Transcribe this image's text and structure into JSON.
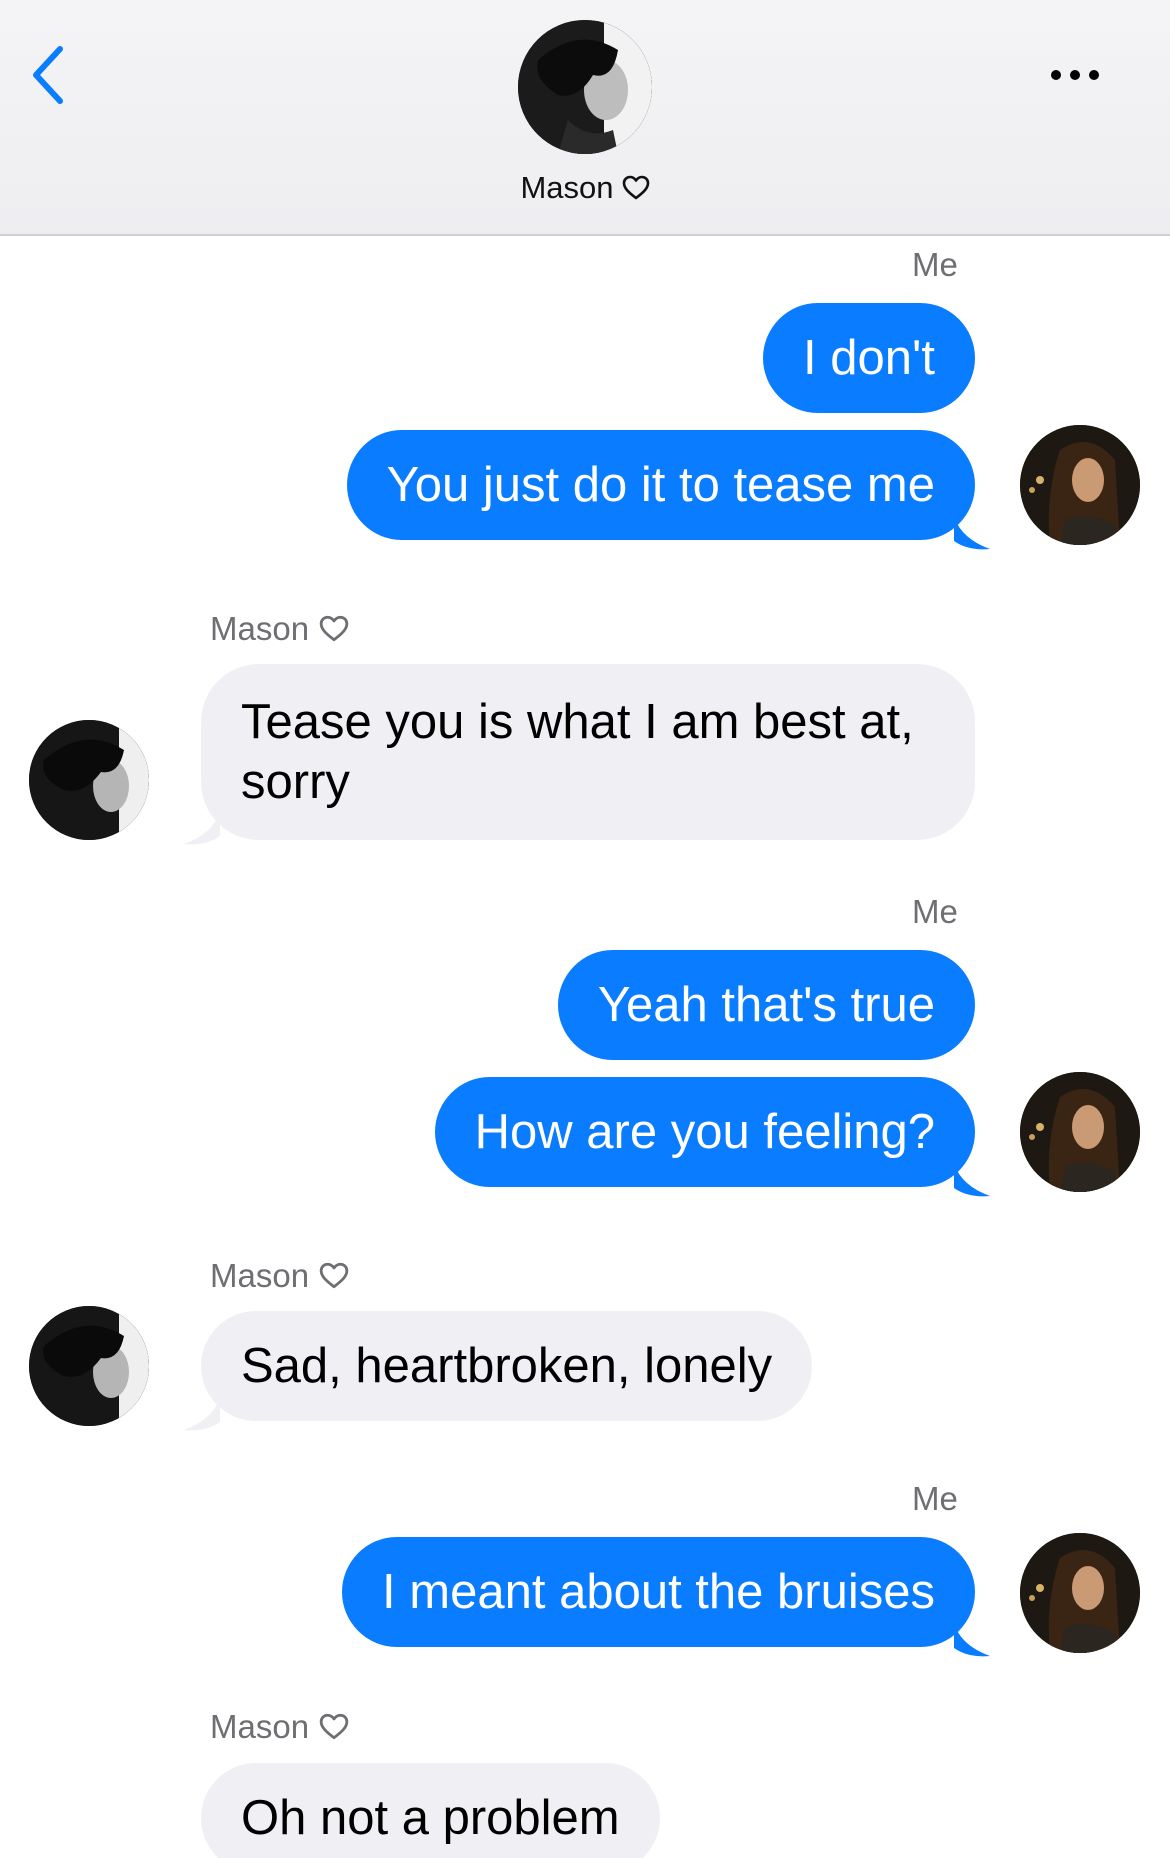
{
  "header": {
    "contact_name": "Mason",
    "back_icon": "chevron-left-icon",
    "more_icon": "ellipsis-icon",
    "heart_icon": "heart-outline-icon",
    "accent_color": "#0a7cff"
  },
  "labels": {
    "me": "Me",
    "mason": "Mason"
  },
  "messages": [
    {
      "from": "me",
      "text": "I don't"
    },
    {
      "from": "me",
      "text": "You just do it to tease me"
    },
    {
      "from": "mason",
      "text": "Tease you is what I am best at, sorry"
    },
    {
      "from": "me",
      "text": "Yeah that's true"
    },
    {
      "from": "me",
      "text": "How are you feeling?"
    },
    {
      "from": "mason",
      "text": "Sad, heartbroken, lonely"
    },
    {
      "from": "me",
      "text": "I meant about the bruises"
    },
    {
      "from": "mason",
      "text": "Oh not a problem"
    }
  ],
  "colors": {
    "outgoing_bubble": "#0a7cff",
    "incoming_bubble": "#f0f0f4",
    "label_gray": "#6e6e73"
  }
}
